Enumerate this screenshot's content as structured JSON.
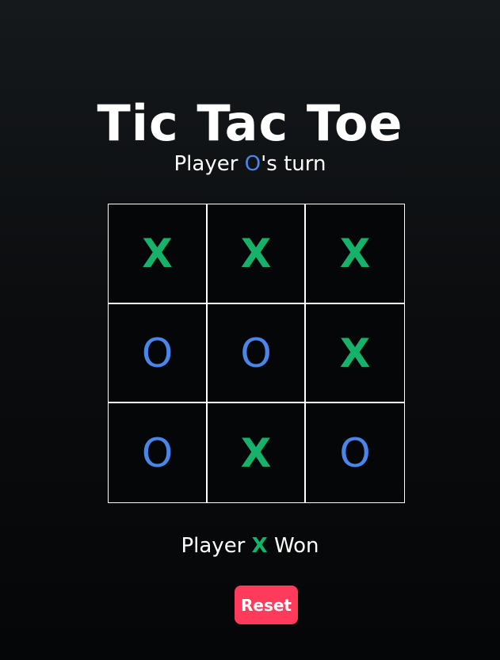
{
  "title": "Tic Tac Toe",
  "turn": {
    "prefix": "Player ",
    "player": "O",
    "suffix": "'s turn"
  },
  "board": [
    [
      "X",
      "X",
      "X"
    ],
    [
      "O",
      "O",
      "X"
    ],
    [
      "O",
      "X",
      "O"
    ]
  ],
  "result": {
    "prefix": "Player ",
    "player": "X",
    "suffix": " Won"
  },
  "reset_label": "Reset",
  "colors": {
    "x": "#17b26a",
    "o": "#4a86e8",
    "reset": "#ff3b5c"
  }
}
